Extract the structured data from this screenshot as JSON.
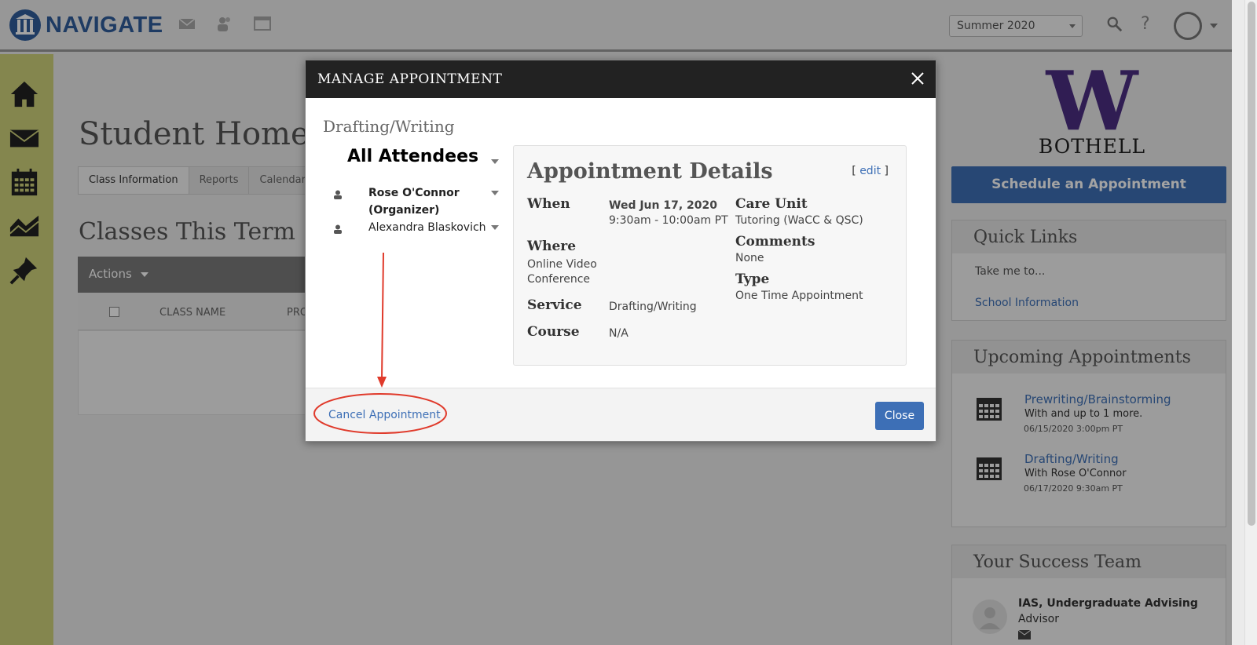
{
  "app": {
    "name": "NAVIGATE",
    "term": "Summer 2020"
  },
  "page": {
    "title": "Student Home",
    "tabs": [
      {
        "label": "Class Information",
        "active": true
      },
      {
        "label": "Reports",
        "active": false
      },
      {
        "label": "Calendar",
        "active": false
      }
    ],
    "section_title": "Classes This Term",
    "actions_label": "Actions",
    "table_headers": [
      "CLASS NAME",
      "PRO"
    ]
  },
  "sidebar": {
    "school_name": "BOTHELL",
    "school_logo_letter": "W",
    "schedule_button": "Schedule an Appointment",
    "quick_links": {
      "title": "Quick Links",
      "intro": "Take me to...",
      "link": "School Information"
    },
    "upcoming": {
      "title": "Upcoming Appointments",
      "items": [
        {
          "title": "Prewriting/Brainstorming",
          "with": "With and up to 1 more.",
          "date": "06/15/2020 3:00pm PT"
        },
        {
          "title": "Drafting/Writing",
          "with": "With Rose O'Connor",
          "date": "06/17/2020 9:30am PT"
        }
      ]
    },
    "success_team": {
      "title": "Your Success Team",
      "member_name": "IAS, Undergraduate Advising",
      "member_role": "Advisor"
    }
  },
  "modal": {
    "title": "MANAGE APPOINTMENT",
    "subtitle": "Drafting/Writing",
    "attendees_title": "All Attendees",
    "attendees": [
      {
        "name_line1": "Rose O'Connor",
        "name_line2": "(Organizer)"
      },
      {
        "name_line1": "Alexandra Blaskovich"
      }
    ],
    "details": {
      "title": "Appointment Details",
      "edit_bracket_open": "[",
      "edit_label": "edit",
      "edit_bracket_close": "]",
      "when_label": "When",
      "when_date": "Wed Jun 17, 2020",
      "when_time": "9:30am - 10:00am PT",
      "where_label": "Where",
      "where_line1": "Online Video",
      "where_line2": "Conference",
      "service_label": "Service",
      "service_value": "Drafting/Writing",
      "course_label": "Course",
      "course_value": "N/A",
      "care_unit_label": "Care Unit",
      "care_unit_value": "Tutoring (WaCC & QSC)",
      "comments_label": "Comments",
      "comments_value": "None",
      "type_label": "Type",
      "type_value": "One Time Appointment"
    },
    "cancel_label": "Cancel Appointment",
    "close_label": "Close"
  },
  "colors": {
    "brand_blue": "#3d6fb6",
    "uw_purple": "#4b2e83",
    "nav_bg": "#cfd27a",
    "annotation_red": "#e03a2b"
  }
}
